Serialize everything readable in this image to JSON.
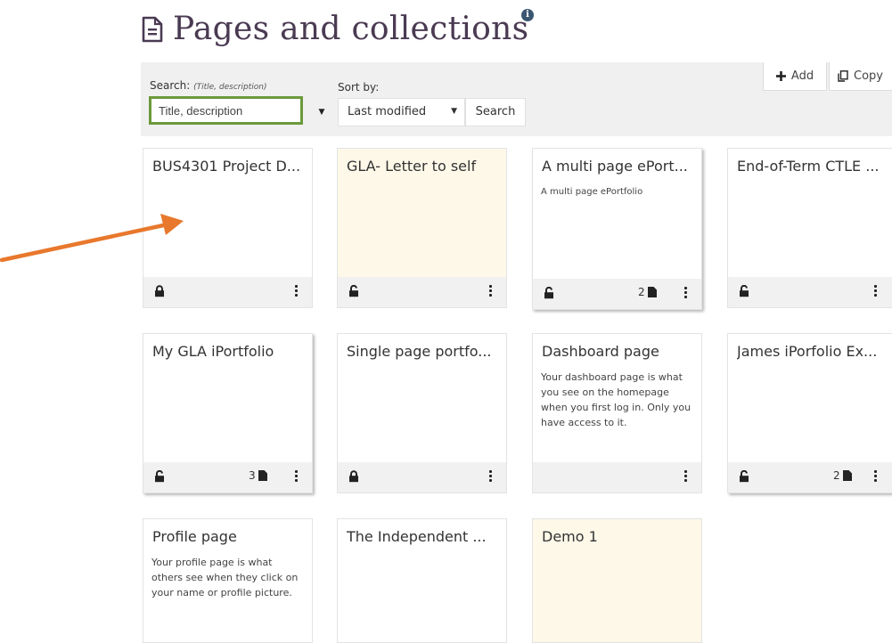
{
  "header": {
    "title": "Pages and collections",
    "title_icon": "document-icon",
    "info_icon": "info-icon"
  },
  "toolbar": {
    "search_label": "Search:",
    "search_hint": "(Title, description)",
    "search_placeholder": "Title, description",
    "sort_label": "Sort by:",
    "sort_value": "Last modified",
    "search_button": "Search",
    "add_button": "Add",
    "copy_button": "Copy"
  },
  "cards": [
    {
      "title": "BUS4301 Project D...",
      "description": "",
      "lock": "closed",
      "pages": ""
    },
    {
      "title": "GLA- Letter to self",
      "description": "",
      "lock": "open",
      "pages": ""
    },
    {
      "title": "A multi page ePort...",
      "description": "A multi page ePortfolio",
      "lock": "open",
      "pages": "2"
    },
    {
      "title": "End-of-Term CTLE ...",
      "description": "",
      "lock": "open",
      "pages": ""
    },
    {
      "title": "My GLA iPortfolio",
      "description": "",
      "lock": "open",
      "pages": "3"
    },
    {
      "title": "Single page portfo...",
      "description": "",
      "lock": "closed",
      "pages": ""
    },
    {
      "title": "Dashboard page",
      "description": "Your dashboard page is what you see on the homepage when you first log in. Only you have access to it.",
      "lock": "none",
      "pages": ""
    },
    {
      "title": "James iPorfolio Ex...",
      "description": "",
      "lock": "open",
      "pages": "2"
    },
    {
      "title": "Profile page",
      "description": "Your profile page is what others see when they click on your name or profile picture.",
      "lock": "none",
      "pages": ""
    },
    {
      "title": "The Independent ...",
      "description": "",
      "lock": "none",
      "pages": ""
    },
    {
      "title": "Demo 1",
      "description": "",
      "lock": "none",
      "pages": ""
    }
  ],
  "colors": {
    "title": "#4a3a52",
    "highlight_card": "#fdf8e8",
    "search_border": "#6c9a3c",
    "arrow": "#e8782c",
    "info_icon": "#3b5671"
  }
}
